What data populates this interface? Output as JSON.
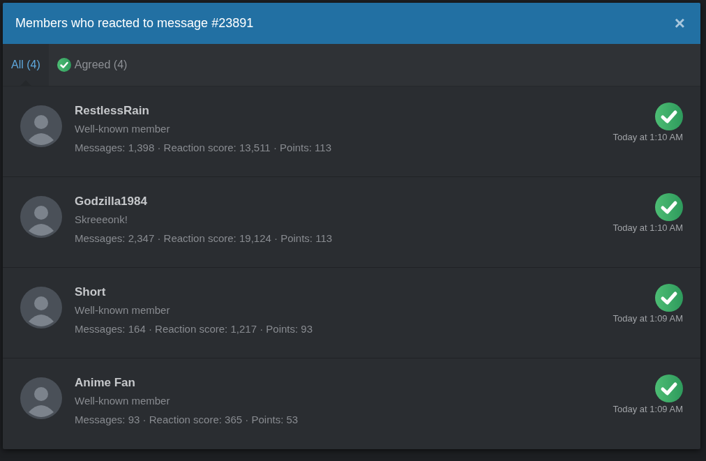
{
  "dialog": {
    "title": "Members who reacted to message #23891",
    "close": "×"
  },
  "tabs": [
    {
      "label": "All (4)",
      "kind": "all",
      "selected": true
    },
    {
      "label": "Agreed (4)",
      "kind": "reaction",
      "selected": false
    }
  ],
  "members": [
    {
      "name": "RestlessRain",
      "title": "Well-known member",
      "stats": "Messages: 1,398 · Reaction score: 13,511 · Points: 113",
      "time": "Today at 1:10 AM"
    },
    {
      "name": "Godzilla1984",
      "title": "Skreeeonk!",
      "stats": "Messages: 2,347 · Reaction score: 19,124 · Points: 113",
      "time": "Today at 1:10 AM"
    },
    {
      "name": "Short",
      "title": "Well-known member",
      "stats": "Messages: 164 · Reaction score: 1,217 · Points: 93",
      "time": "Today at 1:09 AM"
    },
    {
      "name": "Anime Fan",
      "title": "Well-known member",
      "stats": "Messages: 93 · Reaction score: 365 · Points: 53",
      "time": "Today at 1:09 AM"
    }
  ]
}
